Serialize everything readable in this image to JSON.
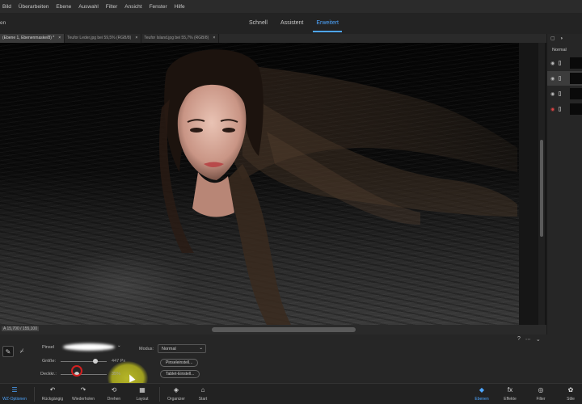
{
  "menu": [
    "Bild",
    "Überarbeiten",
    "Ebene",
    "Auswahl",
    "Filter",
    "Ansicht",
    "Fenster",
    "Hilfe"
  ],
  "modebar": {
    "left_label": "en",
    "modes": [
      {
        "label": "Schnell",
        "active": false
      },
      {
        "label": "Assistent",
        "active": false
      },
      {
        "label": "Erweitert",
        "active": true
      }
    ]
  },
  "tabs": [
    {
      "label": "(Ebene 1, Ebenenmaske/8) *",
      "close": "×",
      "active": true
    },
    {
      "label": "Teufor Leder.jpg bei 59,5% (RGB/8)",
      "close": "×",
      "active": false
    },
    {
      "label": "Teufor Island.jpg bei 55,7% (RGB/8)",
      "close": "×",
      "active": false
    }
  ],
  "status": {
    "text": "A 15,700 / 155,100"
  },
  "right_panel": {
    "blend_mode": "Normal",
    "layers": [
      {
        "thumb": "dark",
        "selected": false
      },
      {
        "thumb": "dark",
        "selected": true
      },
      {
        "thumb": "dark",
        "selected": false
      },
      {
        "thumb": "red",
        "selected": false
      }
    ]
  },
  "options": {
    "pinsel_label": "Pinsel",
    "groesse_label": "Größe:",
    "groesse_value": "447 Px",
    "groesse_fraction": 0.75,
    "deckkr_label": "Deckkr.:",
    "deckkr_value": "35%",
    "deckkr_fraction": 0.35,
    "modus_label": "Modus:",
    "modus_value": "Normal",
    "pinsel_einst": "Pinseleinstell...",
    "tablet_einst": "Tablet-Einstell...",
    "icons": [
      "?",
      "⋯",
      "⌄"
    ]
  },
  "taskbar": [
    {
      "label": "WZ-Optionen",
      "icon": "☰",
      "blue": true
    },
    {
      "label": "Rückgängig",
      "icon": "↶",
      "blue": false
    },
    {
      "label": "Wiederholen",
      "icon": "↷",
      "blue": false
    },
    {
      "label": "Drehen",
      "icon": "⟲",
      "blue": false
    },
    {
      "label": "Layout",
      "icon": "▦",
      "blue": false
    },
    {
      "label": "Organizer",
      "icon": "◈",
      "blue": false
    },
    {
      "label": "Start",
      "icon": "⌂",
      "blue": false
    },
    {
      "label": "Ebenen",
      "icon": "◆",
      "blue": true
    },
    {
      "label": "Effekte",
      "icon": "fx",
      "blue": false
    },
    {
      "label": "Filter",
      "icon": "◎",
      "blue": false
    },
    {
      "label": "Stile",
      "icon": "✿",
      "blue": false
    }
  ]
}
